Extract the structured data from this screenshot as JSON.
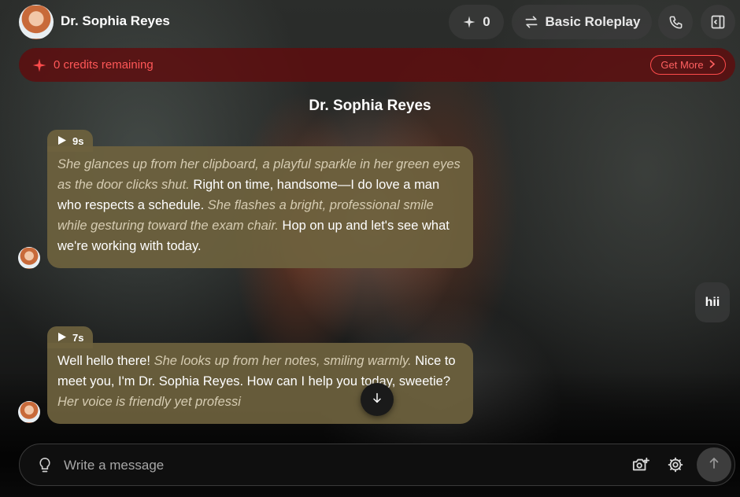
{
  "header": {
    "character_name": "Dr. Sophia Reyes",
    "credits_count": "0",
    "mode_label": "Basic Roleplay",
    "icons": {
      "credits": "sparkle-icon",
      "mode": "swap-arrows-icon",
      "call": "phone-icon",
      "panel": "sidebar-panel-icon"
    }
  },
  "banner": {
    "text": "0 credits remaining",
    "button_label": "Get More",
    "color": "#ff5757"
  },
  "chat": {
    "title": "Dr. Sophia Reyes",
    "messages": [
      {
        "role": "character",
        "audio_duration": "9s",
        "segments": [
          {
            "italic": true,
            "text": "She glances up from her clipboard, a playful sparkle in her green eyes as the door clicks shut."
          },
          {
            "italic": false,
            "text": " Right on time, handsome—I do love a man who respects a schedule. "
          },
          {
            "italic": true,
            "text": "She flashes a bright, professional smile while gesturing toward the exam chair."
          },
          {
            "italic": false,
            "text": " Hop on up and let's see what we're working with today."
          }
        ]
      },
      {
        "role": "user",
        "text": "hii"
      },
      {
        "role": "character",
        "audio_duration": "7s",
        "segments": [
          {
            "italic": false,
            "text": "Well hello there! "
          },
          {
            "italic": true,
            "text": "She looks up from her notes, smiling warmly."
          },
          {
            "italic": false,
            "text": " Nice to meet you, I'm Dr. Sophia Reyes. How can I help you today, sweetie? "
          },
          {
            "italic": true,
            "text": "Her voice is friendly yet professi"
          }
        ]
      }
    ]
  },
  "composer": {
    "placeholder": "Write a message",
    "icons": [
      "lightbulb-icon",
      "camera-plus-icon",
      "gear-icon",
      "arrow-up-icon"
    ]
  },
  "colors": {
    "bubble": "#6e623e",
    "banner_bg": "#5f0c0e",
    "accent_red": "#ff4b4b"
  }
}
